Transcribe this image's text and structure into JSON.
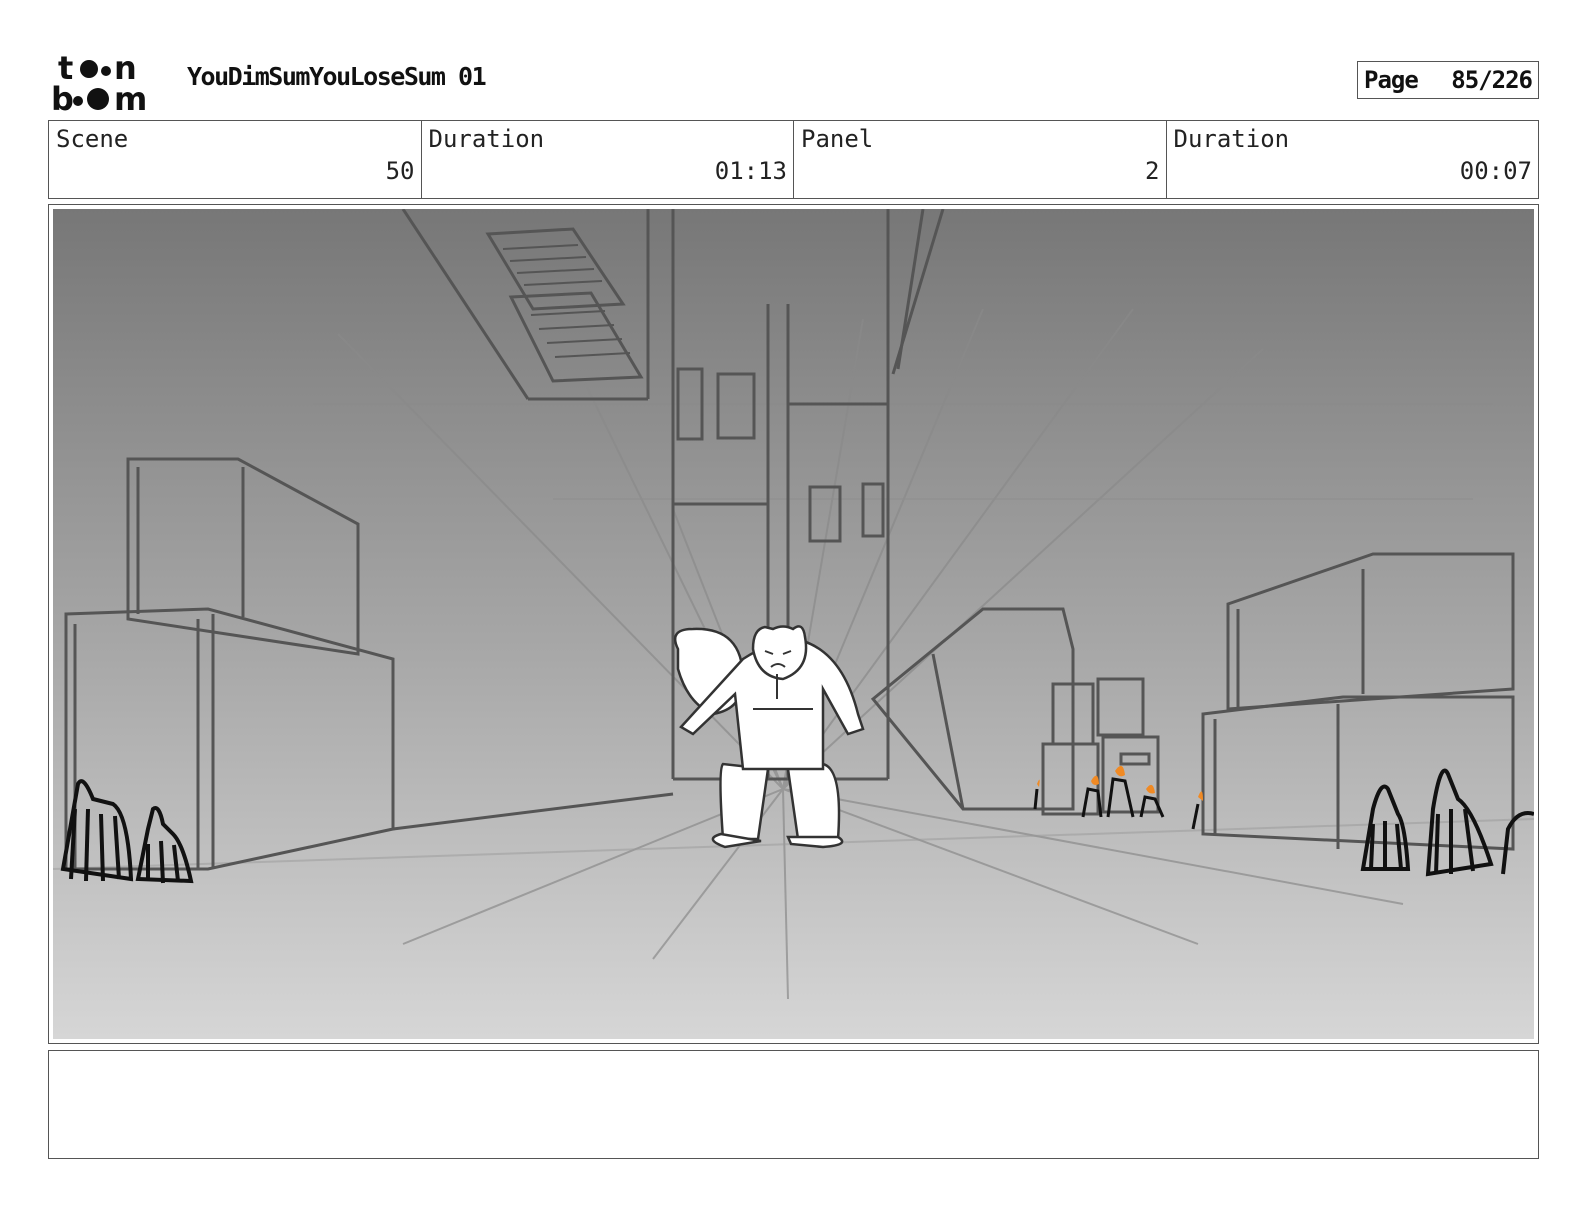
{
  "header": {
    "logo_text": "toon boom",
    "project_title": "YouDimSumYouLoseSum 01",
    "page_label": "Page",
    "page_number": "85/226"
  },
  "info": [
    {
      "label": "Scene",
      "value": "50"
    },
    {
      "label": "Duration",
      "value": "01:13"
    },
    {
      "label": "Panel",
      "value": "2"
    },
    {
      "label": "Duration",
      "value": "00:07"
    }
  ],
  "panel": {
    "icon": "storyboard-sketch-image"
  },
  "notes": {
    "text": ""
  },
  "colors": {
    "frame_border": "#555555",
    "sky_top": "#777777",
    "ground_bottom": "#d4d4d4",
    "flame": "#f08a24"
  }
}
